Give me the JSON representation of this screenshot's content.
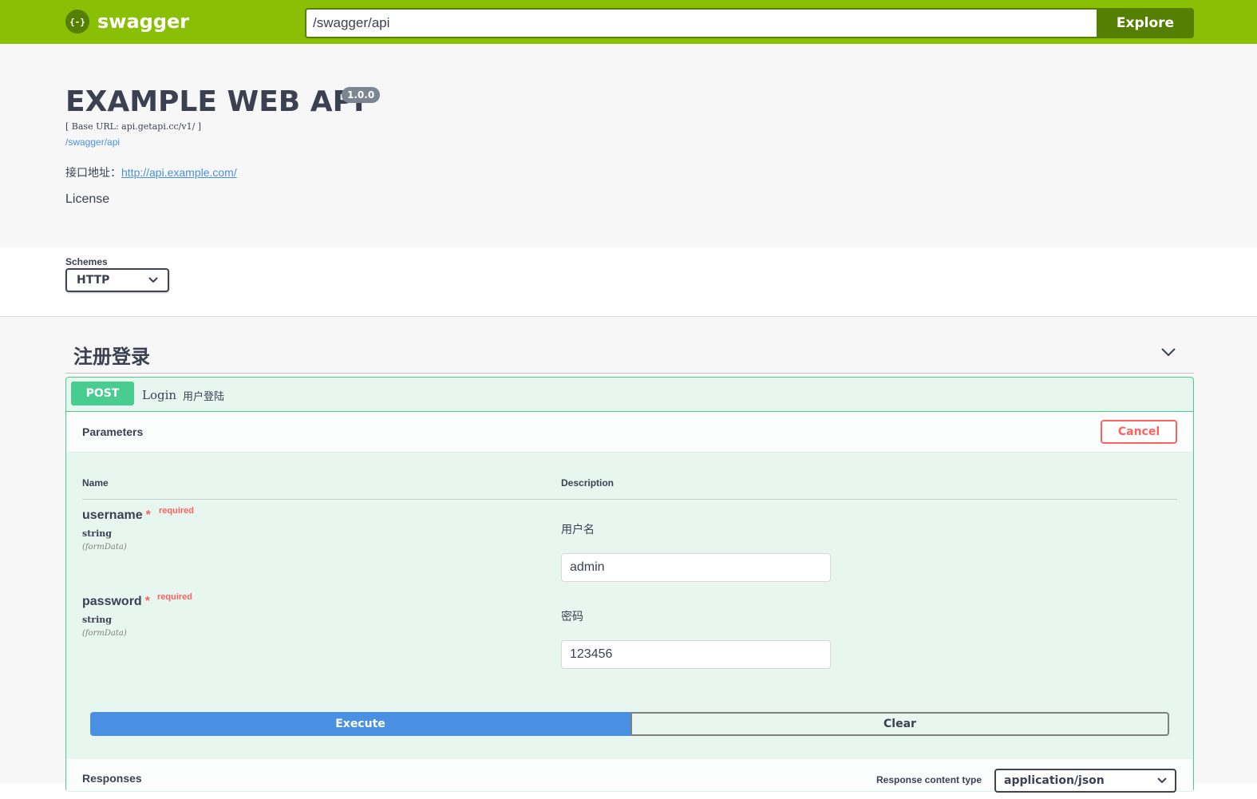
{
  "topbar": {
    "logo_glyph": "{-}",
    "logo_text": "swagger",
    "url_value": "/swagger/api",
    "explore_label": "Explore",
    "bar_color": "#89bf04",
    "dark_color": "#547f00"
  },
  "info": {
    "title": "EXAMPLE WEB API",
    "version": "1.0.0",
    "base_url": "[ Base URL: api.getapi.cc/v1/ ]",
    "spec_link": "/swagger/api",
    "api_address_label": "接口地址：",
    "api_address_url": "http://api.example.com/",
    "license": "License"
  },
  "schemes": {
    "label": "Schemes",
    "selected": "HTTP"
  },
  "tag": {
    "name": "注册登录",
    "toggle_icon": "chevron-down-icon"
  },
  "operation": {
    "method": "POST",
    "path": "Login",
    "summary": "用户登陆",
    "method_color": "#49cc90",
    "parameters_title": "Parameters",
    "cancel_label": "Cancel",
    "col_name": "Name",
    "col_description": "Description",
    "params": [
      {
        "name": "username",
        "star": "*",
        "required": "required",
        "type": "string",
        "in": "(formData)",
        "description": "用户名",
        "value": "admin"
      },
      {
        "name": "password",
        "star": "*",
        "required": "required",
        "type": "string",
        "in": "(formData)",
        "description": "密码",
        "value": "123456"
      }
    ],
    "execute_label": "Execute",
    "clear_label": "Clear",
    "responses_title": "Responses",
    "response_content_type_label": "Response content type",
    "response_content_type": "application/json"
  }
}
